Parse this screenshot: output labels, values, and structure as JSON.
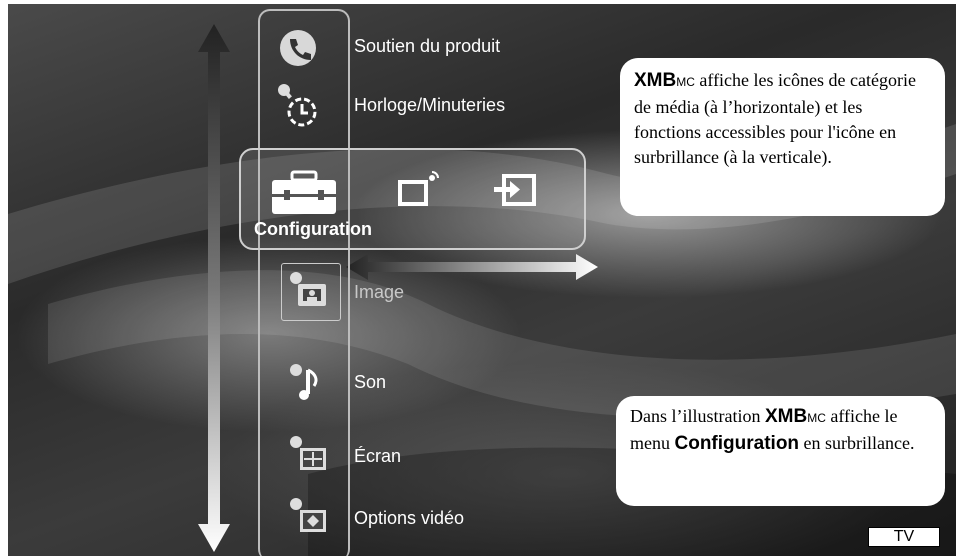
{
  "menu": {
    "items": [
      {
        "label": "Soutien du produit",
        "icon": "phone-icon"
      },
      {
        "label": "Horloge/Minuteries",
        "icon": "clock-timer-icon"
      },
      {
        "label": "Image",
        "icon": "image-settings-icon"
      },
      {
        "label": "Son",
        "icon": "sound-settings-icon"
      },
      {
        "label": "Écran",
        "icon": "screen-settings-icon"
      },
      {
        "label": "Options vidéo",
        "icon": "video-options-icon"
      }
    ],
    "category": {
      "label": "Configuration",
      "icons": [
        "toolbox-icon",
        "tv-widget-icon",
        "input-icon"
      ]
    }
  },
  "callout_top": {
    "brand": "XMB",
    "brand_sup": "MC",
    "text": " affiche les icônes de catégorie de média (à l’horizontale) et les fonctions accessibles pour l'icône en surbrillance (à la verticale)."
  },
  "callout_bottom": {
    "text_a": "Dans l’illustration ",
    "brand": "XMB",
    "brand_sup": "MC",
    "text_b": " affiche le menu ",
    "menu_name": "Configuration",
    "text_c": " en surbrillance."
  },
  "badge": "TV",
  "colors": {
    "callout_bg": "#ffffff",
    "label": "#ffffff",
    "dimmed_label": "#c8c8c8"
  }
}
